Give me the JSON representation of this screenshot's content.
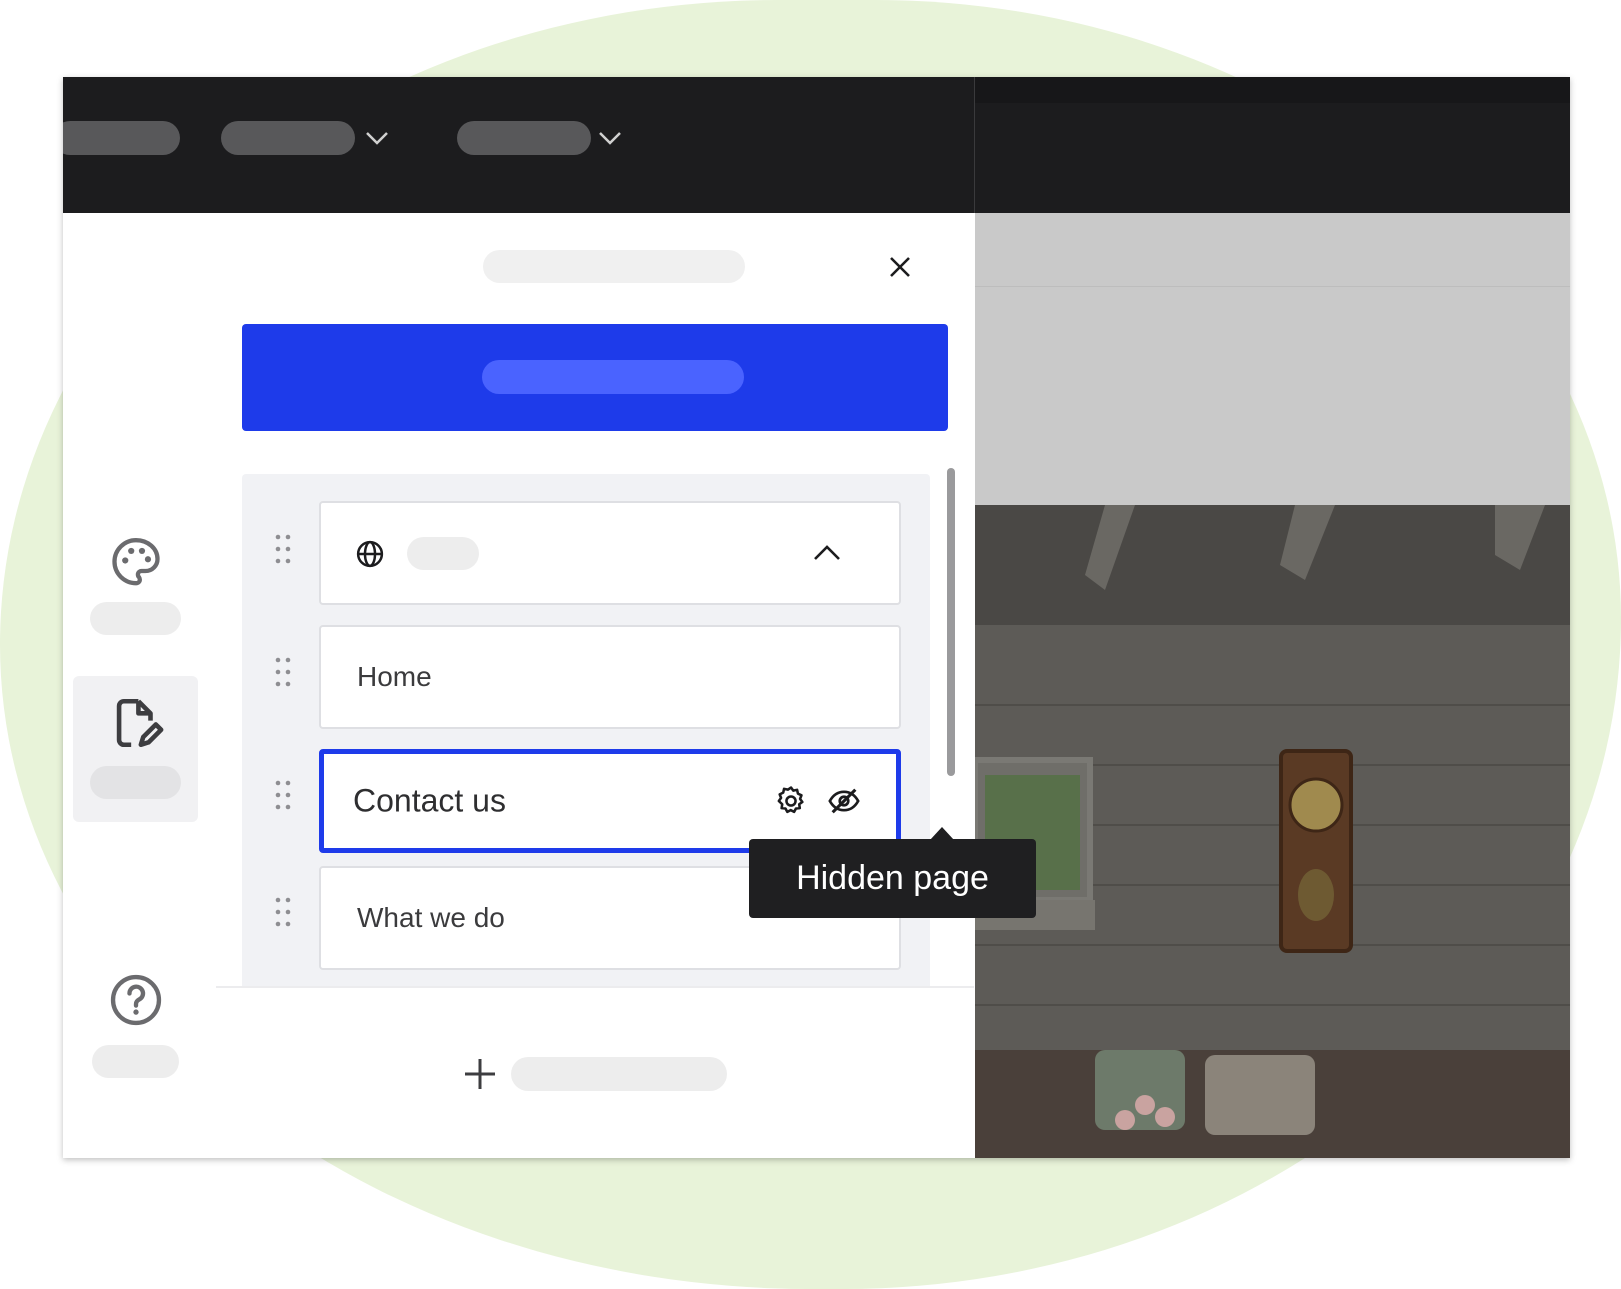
{
  "pages_panel": {
    "items": [
      {
        "type": "folder",
        "label": "",
        "icon": "globe-icon",
        "expanded": true
      },
      {
        "type": "page",
        "label": "Home"
      },
      {
        "type": "page",
        "label": "Contact us",
        "selected": true,
        "actions": [
          "gear-icon",
          "eye-off-icon"
        ]
      },
      {
        "type": "page",
        "label": "What we do"
      }
    ]
  },
  "tooltip": {
    "text": "Hidden page"
  },
  "colors": {
    "accent": "#1e3bea",
    "topbar": "#1c1c1e",
    "background_blob": "#e8f3d9"
  }
}
